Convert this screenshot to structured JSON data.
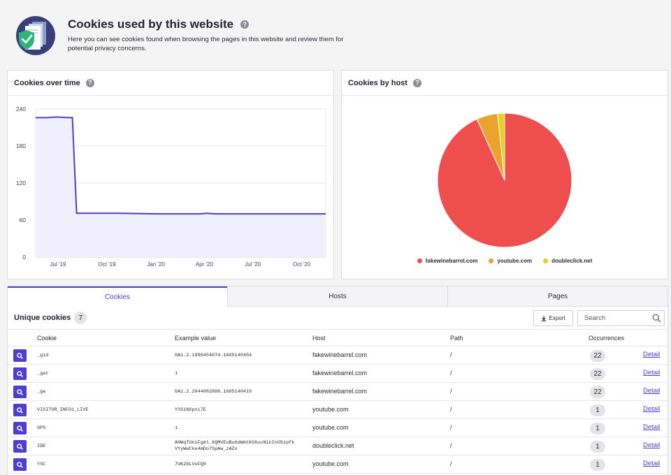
{
  "header": {
    "title": "Cookies used by this website",
    "help_icon": "question-icon",
    "description": "Here you can see cookies found when browsing the pages in this website and review them for potential privacy concerns."
  },
  "line_card": {
    "title": "Cookies over time"
  },
  "pie_card": {
    "title": "Cookies by host"
  },
  "chart_data": [
    {
      "type": "area",
      "y_ticks": [
        240,
        180,
        120,
        60,
        0
      ],
      "ylim": [
        0,
        240
      ],
      "x_tick_labels": [
        "Jul '19",
        "Oct '19",
        "Jan '20",
        "Apr '20",
        "Jul '20",
        "Oct '20"
      ],
      "x": [
        "2019-05-20",
        "2019-06-10",
        "2019-06-28",
        "2019-07-20",
        "2019-07-28",
        "2019-08-05",
        "2019-09-15",
        "2019-10-20",
        "2020-01-01",
        "2020-03-01",
        "2020-03-25",
        "2020-04-05",
        "2020-04-20",
        "2020-05-15",
        "2020-08-01",
        "2020-11-15"
      ],
      "y": [
        226,
        226,
        227,
        226,
        226,
        71,
        71,
        71,
        70,
        70,
        70,
        71,
        70,
        70,
        70,
        70
      ],
      "color": "#4c3fcf",
      "fill": "#f1effb"
    },
    {
      "type": "pie",
      "labels": [
        "fakewinebarrel.com",
        "youtube.com",
        "doubleclick.net"
      ],
      "values": [
        22,
        1.2,
        0.4
      ],
      "colors": [
        "#ef4e4e",
        "#eba22e",
        "#ead01c"
      ],
      "legend": "bottom"
    }
  ],
  "tabs": [
    {
      "label": "Cookies",
      "active": true
    },
    {
      "label": "Hosts",
      "active": false
    },
    {
      "label": "Pages",
      "active": false
    }
  ],
  "toolbar": {
    "unique_label": "Unique cookies",
    "count": "7",
    "export_label": "Export",
    "search_placeholder": "Search",
    "search_value": ""
  },
  "table": {
    "headers": {
      "cookie": "Cookie",
      "value": "Example value",
      "host": "Host",
      "path": "Path",
      "occurrences": "Occurrences"
    },
    "detail_label": "Detail",
    "rows": [
      {
        "cookie": "_gid",
        "value": "GA1.2.1996454074.1605140454",
        "value2": "",
        "host": "fakewinebarrel.com",
        "path": "/",
        "occurrences": "22"
      },
      {
        "cookie": "_gat",
        "value": "1",
        "value2": "",
        "host": "fakewinebarrel.com",
        "path": "/",
        "occurrences": "22"
      },
      {
        "cookie": "_ga",
        "value": "GA1.2.2044082888.1605140419",
        "value2": "",
        "host": "fakewinebarrel.com",
        "path": "/",
        "occurrences": "22"
      },
      {
        "cookie": "VISITOR_INFO1_LIVE",
        "value": "YSSiNXpni7E",
        "value2": "",
        "host": "youtube.com",
        "path": "/",
        "occurrences": "1"
      },
      {
        "cookie": "GPS",
        "value": "1",
        "value2": "",
        "host": "youtube.com",
        "path": "/",
        "occurrences": "1"
      },
      {
        "cookie": "IDE",
        "value": "AHWqTUkiFgml_6QMVEuBu6dWmtKG6uvNikInO5zpfk",
        "value2": "VYyWwCke4mDo7SpAw_zAZx",
        "host": "doubleclick.net",
        "path": "/",
        "occurrences": "1"
      },
      {
        "cookie": "YSC",
        "value": "7UK2GLVvFQ0",
        "value2": "",
        "host": "youtube.com",
        "path": "/",
        "occurrences": "1"
      }
    ]
  }
}
